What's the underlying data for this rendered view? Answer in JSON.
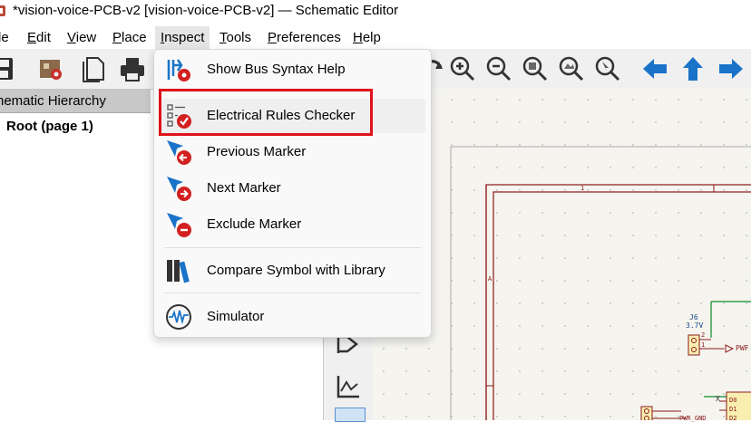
{
  "window": {
    "title": "*vision-voice-PCB-v2 [vision-voice-PCB-v2] — Schematic Editor"
  },
  "menubar": {
    "items": [
      {
        "label": "le",
        "underline": ""
      },
      {
        "label": "dit",
        "underline": "E"
      },
      {
        "label": "iew",
        "underline": "V"
      },
      {
        "label": "lace",
        "underline": "P"
      },
      {
        "label": "nspect",
        "underline": "I"
      },
      {
        "label": "ools",
        "underline": "T"
      },
      {
        "label": "references",
        "underline": "P"
      },
      {
        "label": "elp",
        "underline": "H"
      }
    ]
  },
  "hierarchy": {
    "title": "hematic Hierarchy",
    "root": "Root (page 1)"
  },
  "inspect_menu": {
    "items": [
      {
        "label": "Show Bus Syntax Help",
        "icon": "bus-syntax-help-icon"
      },
      {
        "label": "Electrical Rules Checker",
        "icon": "erc-icon",
        "highlighted": true
      },
      {
        "label": "Previous Marker",
        "icon": "previous-marker-icon"
      },
      {
        "label": "Next Marker",
        "icon": "next-marker-icon"
      },
      {
        "label": "Exclude Marker",
        "icon": "exclude-marker-icon"
      },
      {
        "label": "Compare Symbol with Library",
        "icon": "compare-library-icon"
      },
      {
        "label": "Simulator",
        "icon": "simulator-icon"
      }
    ]
  },
  "schematic": {
    "frame_col": "1",
    "frame_row": "A",
    "ref": "J6",
    "value": "3.7V",
    "pin1": "1",
    "pin2": "2",
    "net": "PWF",
    "pin_d0": "D0",
    "pin_d1": "D1",
    "pin_d2": "D2",
    "net2": "PWR_GND",
    "x_mark": "X"
  },
  "colors": {
    "highlight_box": "#e0121b",
    "accent_blue": "#1a73c8",
    "marker_red": "#d32020",
    "frame": "#8b1a1a"
  }
}
